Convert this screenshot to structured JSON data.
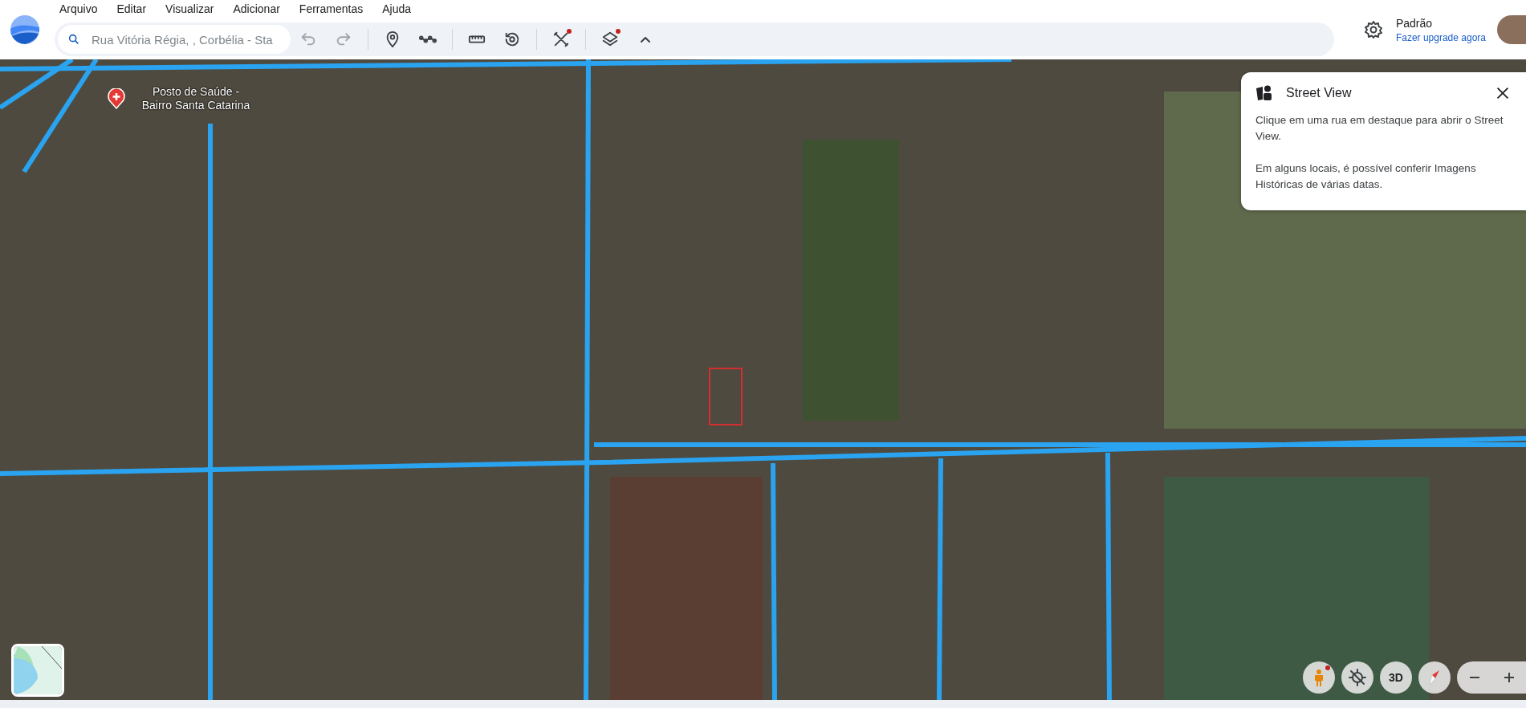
{
  "menu": [
    "Arquivo",
    "Editar",
    "Visualizar",
    "Adicionar",
    "Ferramentas",
    "Ajuda"
  ],
  "search": {
    "placeholder": "Rua Vitória Régia, , Corbélia - Sta"
  },
  "history": {
    "undo_disabled": true,
    "redo_disabled": true
  },
  "account": {
    "plan": "Padrão",
    "upgrade_link": "Fazer upgrade agora"
  },
  "map": {
    "place_label": "Posto de Saúde - Bairro Santa Catarina"
  },
  "street_view_panel": {
    "title": "Street View",
    "paragraphs": [
      "Clique em uma rua em destaque para abrir o Street View.",
      "Em alguns locais, é possível conferir Imagens Históricas de várias datas."
    ]
  },
  "map_controls": {
    "three_d_label": "3D"
  }
}
